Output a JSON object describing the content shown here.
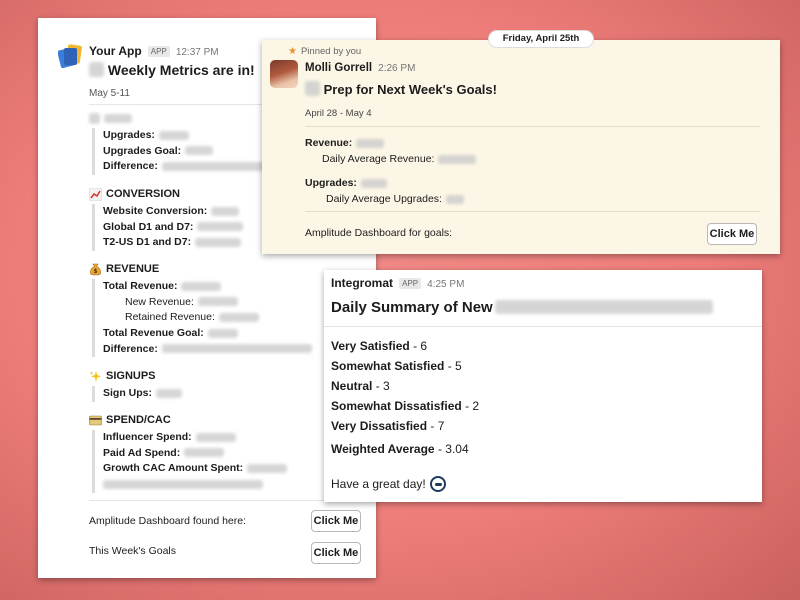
{
  "left_card": {
    "app_name": "Your App",
    "app_badge": "APP",
    "time": "12:37 PM",
    "title": "Weekly Metrics are in!",
    "date_range": "May 5-11",
    "upgrades_section": {
      "rows": [
        {
          "label": "Upgrades:"
        },
        {
          "label": "Upgrades Goal:"
        },
        {
          "label": "Difference:"
        }
      ]
    },
    "conversion": {
      "heading": "CONVERSION",
      "icon": "chart-increasing-icon",
      "rows": [
        {
          "label": "Website Conversion:"
        },
        {
          "label": "Global D1 and D7:"
        },
        {
          "label": "T2-US D1 and D7:"
        }
      ]
    },
    "revenue": {
      "heading": "REVENUE",
      "icon": "money-bag-icon",
      "rows": [
        {
          "label": "Total Revenue:"
        },
        {
          "label": "New Revenue:"
        },
        {
          "label": "Retained Revenue:"
        },
        {
          "label": "Total Revenue Goal:"
        },
        {
          "label": "Difference:"
        }
      ]
    },
    "signups": {
      "heading": "SIGNUPS",
      "icon": "sparkles-icon",
      "rows": [
        {
          "label": "Sign Ups:"
        }
      ]
    },
    "spend": {
      "heading": "SPEND/CAC",
      "icon": "credit-card-icon",
      "rows": [
        {
          "label": "Influencer Spend:"
        },
        {
          "label": "Paid Ad Spend:"
        },
        {
          "label": "Growth CAC Amount Spent:"
        }
      ]
    },
    "footer1_label": "Amplitude Dashboard found here:",
    "footer2_label": "This Week's Goals",
    "button_label": "Click Me"
  },
  "pinned_card": {
    "pinned_label": "Pinned by you",
    "date_pill": "Friday, April 25th",
    "author": "Molli Gorrell",
    "time": "2:26 PM",
    "title": "Prep for Next Week's Goals!",
    "date_range": "April 28 - May 4",
    "revenue_label": "Revenue:",
    "daily_revenue_label": "Daily Average Revenue:",
    "upgrades_label": "Upgrades:",
    "daily_upgrades_label": "Daily Average Upgrades:",
    "footer_label": "Amplitude Dashboard for goals:",
    "button_label": "Click Me"
  },
  "summary_card": {
    "app_name": "Integromat",
    "app_badge": "APP",
    "time": "4:25 PM",
    "title": "Daily Summary of New",
    "ratings": [
      {
        "label": "Very Satisfied",
        "value": "- 6"
      },
      {
        "label": "Somewhat Satisfied",
        "value": "- 5"
      },
      {
        "label": "Neutral",
        "value": "- 3"
      },
      {
        "label": "Somewhat Dissatisfied",
        "value": "- 2"
      },
      {
        "label": "Very Dissatisfied",
        "value": "- 7"
      }
    ],
    "weighted_label": "Weighted Average",
    "weighted_value": "- 3.04",
    "closing": "Have a great day!"
  },
  "colors": {
    "background": "#ee7d7a",
    "pinned_bg": "#fcf6e6",
    "pin_accent": "#e8912d"
  }
}
